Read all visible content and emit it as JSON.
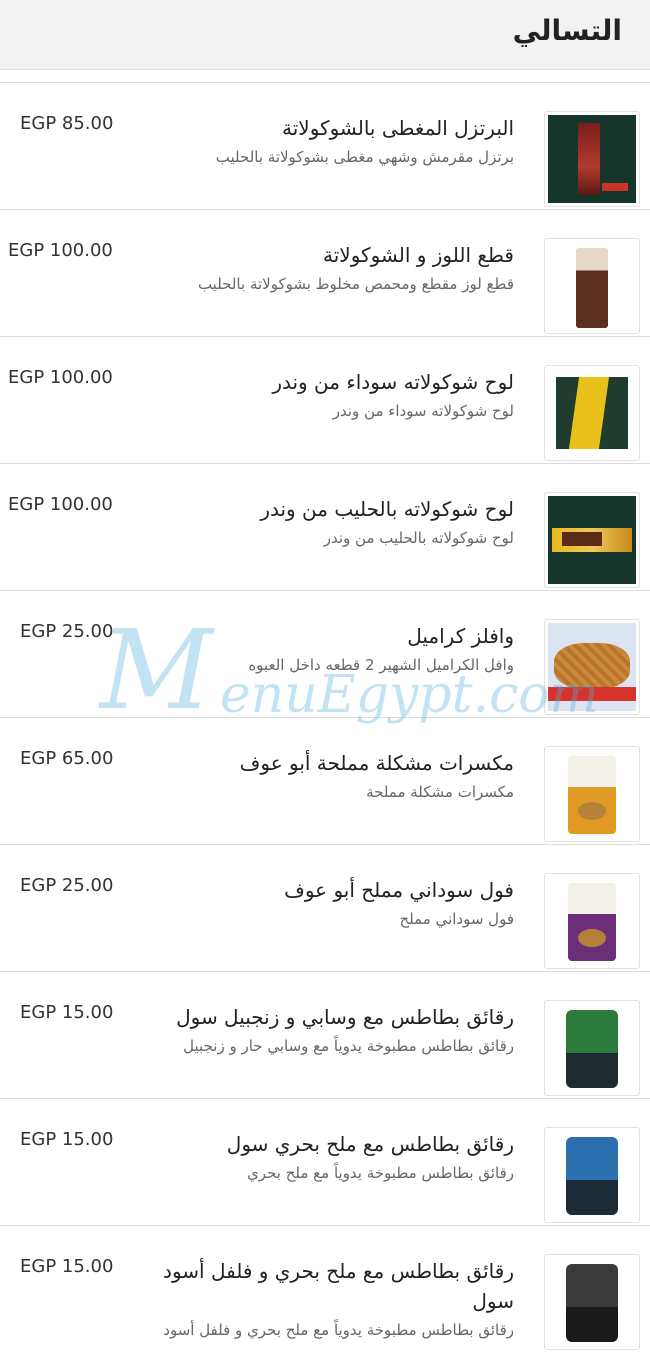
{
  "header": {
    "title": "التسالي"
  },
  "items": [
    {
      "name": "البرتزل المغطى بالشوكولاتة",
      "desc": "برتزل مقرمش وشهي مغطى بشوكولاتة بالحليب",
      "price": "EGP 85.00",
      "image_icon": "starbucks-pretzel-icon"
    },
    {
      "name": "قطع اللوز و الشوكولاتة",
      "desc": "قطع لوز مقطع ومحمص مخلوط بشوكولاتة بالحليب",
      "price": "EGP 100.00",
      "image_icon": "almond-chocolate-icon"
    },
    {
      "name": "لوح شوكولاته سوداء من وندر",
      "desc": "لوح شوكولاته سوداء من وندر",
      "price": "EGP 100.00",
      "image_icon": "wonder-dark-bar-icon"
    },
    {
      "name": "لوح شوكولاته بالحليب من وندر",
      "desc": "لوح شوكولاته بالحليب من وندر",
      "price": "EGP 100.00",
      "image_icon": "wonder-milk-bar-icon"
    },
    {
      "name": "وافلز كراميل",
      "desc": "وافل الكراميل الشهير 2 قطعه داخل العبوه",
      "price": "EGP 25.00",
      "image_icon": "stroopwafel-icon"
    },
    {
      "name": "مكسرات مشكلة مملحة أبو عوف",
      "desc": "مكسرات مشكلة مملحة",
      "price": "EGP 65.00",
      "image_icon": "abu-auf-mixed-nuts-icon"
    },
    {
      "name": "فول سوداني مملح أبو عوف",
      "desc": "فول سوداني مملح",
      "price": "EGP 25.00",
      "image_icon": "abu-auf-peanuts-icon"
    },
    {
      "name": "رقائق بطاطس مع وسابي و زنجبيل سول",
      "desc": "رقائق بطاطس مطبوخة يدوياً مع وسابي حار و زنجبيل",
      "price": "EGP 15.00",
      "image_icon": "soul-wasabi-chips-icon"
    },
    {
      "name": "رقائق بطاطس مع ملح بحري سول",
      "desc": "رقائق بطاطس مطبوخة يدوياً مع ملح بحري",
      "price": "EGP 15.00",
      "image_icon": "soul-sea-salt-chips-icon"
    },
    {
      "name": "رقائق بطاطس مع ملح بحري و فلفل أسود سول",
      "desc": "رقائق بطاطس مطبوخة يدوياً مع ملح بحري و فلفل أسود",
      "price": "EGP 15.00",
      "image_icon": "soul-salt-pepper-chips-icon"
    }
  ],
  "watermark": {
    "initial": "M",
    "rest": "enuEgypt.com"
  },
  "colors": {
    "header_bg": "#f2f2f2",
    "divider": "#dcdcdc",
    "watermark": "#50afdc"
  }
}
